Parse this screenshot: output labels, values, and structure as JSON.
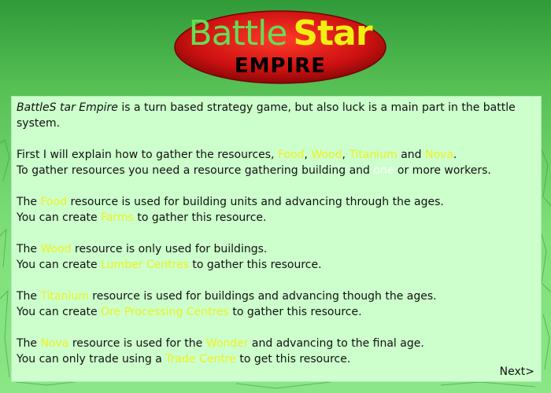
{
  "logo": {
    "title_word1": "Battle",
    "title_word2": "Star",
    "subtitle": "EMPIRE",
    "colors": {
      "ellipse": "#cc1111",
      "word1": "#66dd55",
      "word2": "#f2f010"
    }
  },
  "intro": {
    "game_name": "BattleS tar Empire",
    "rest": " is a turn based strategy game, but also luck is a main part in the battle system."
  },
  "gather": {
    "line1_prefix": "First I will explain how to gather the resources, ",
    "food": "Food",
    "sep1": ", ",
    "wood": "Wood",
    "sep2": ", ",
    "titanium": "Titanium",
    "and": " and ",
    "nova": "Nova",
    "end": ".",
    "line2_prefix": "To gather resources you need a resource gathering building and ",
    "one": "one",
    "line2_suffix": " or more workers."
  },
  "food_para": {
    "l1_a": "The ",
    "l1_hl": "Food",
    "l1_b": " resource is used for building units and advancing through the ages.",
    "l2_a": "You can create ",
    "l2_hl": "Farms",
    "l2_b": " to gather this resource."
  },
  "wood_para": {
    "l1_a": "The ",
    "l1_hl": "Wood",
    "l1_b": " resource is only used for buildings.",
    "l2_a": "You can create ",
    "l2_hl": "Lumber Centres",
    "l2_b": " to gather this resource."
  },
  "titanium_para": {
    "l1_a": "The ",
    "l1_hl": "Titanium",
    "l1_b": " resource is used for buildings and advancing though the ages.",
    "l2_a": "You can create ",
    "l2_hl": "Ore Processing Centres",
    "l2_b": " to gather this resource."
  },
  "nova_para": {
    "l1_a": "The ",
    "l1_hl": "Nova",
    "l1_b": " resource is used for the ",
    "l1_hl2": "Wonder",
    "l1_c": " and advancing to the final age.",
    "l2_a": "You can only trade using a ",
    "l2_hl": "Trade Centre",
    "l2_b": " to get this resource."
  },
  "nav": {
    "next_label": "Next>"
  },
  "colors": {
    "panel_bg": "#ccffcc",
    "highlight": "#f0f020",
    "background": "#5cc45a"
  }
}
